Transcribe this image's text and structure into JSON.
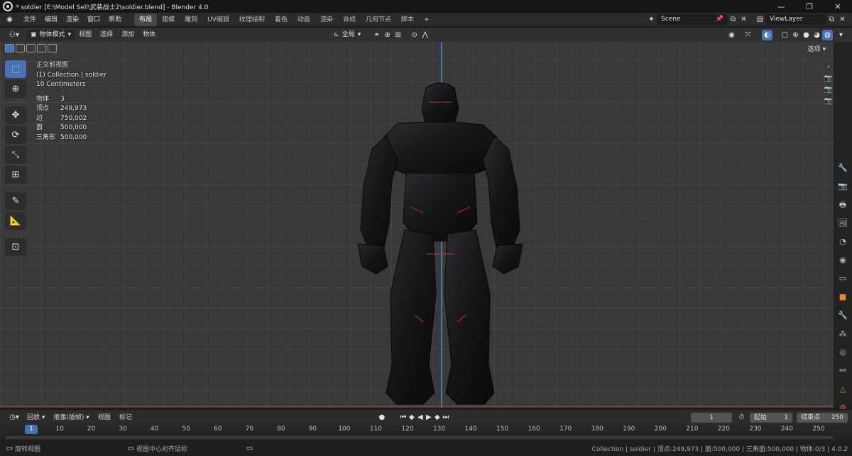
{
  "titlebar": {
    "title": "* soldier [E:\\Model Sell\\武装战士2\\soldier.blend] - Blender 4.0",
    "minimize": "—",
    "maximize": "❐",
    "close": "✕"
  },
  "menus": [
    "文件",
    "编辑",
    "渲染",
    "窗口",
    "帮助"
  ],
  "workspaces": [
    "布局",
    "建模",
    "雕刻",
    "UV编辑",
    "纹理绘制",
    "着色",
    "动画",
    "渲染",
    "合成",
    "几何节点",
    "脚本"
  ],
  "workspace_add": "+",
  "scene": "Scene",
  "view_layer": "ViewLayer",
  "header": {
    "mode": "物体模式",
    "view": "视图",
    "select": "选择",
    "add": "添加",
    "object": "物体",
    "orientation": "全局"
  },
  "overlay": {
    "view_name": "正交前视图",
    "collection": "(1) Collection | soldier",
    "scale": "10 Centimeters"
  },
  "stats": [
    {
      "k": "物体",
      "v": "3"
    },
    {
      "k": "顶点",
      "v": "249,973"
    },
    {
      "k": "边",
      "v": "750,002"
    },
    {
      "k": "面",
      "v": "500,000"
    },
    {
      "k": "三角形",
      "v": "500,000"
    }
  ],
  "options_label": "选项",
  "timeline": {
    "playback": "回放",
    "keying": "抠像(插帧)",
    "view": "视图",
    "marker": "标记",
    "current_frame": "1",
    "start_label": "起始",
    "start": "1",
    "end_label": "结束点",
    "end": "250"
  },
  "ruler_ticks": [
    "1",
    "10",
    "20",
    "30",
    "40",
    "50",
    "60",
    "70",
    "80",
    "90",
    "100",
    "110",
    "120",
    "130",
    "140",
    "150",
    "160",
    "170",
    "180",
    "190",
    "200",
    "210",
    "220",
    "230",
    "240",
    "250"
  ],
  "status": {
    "left": "旋转视图",
    "middle": "视图中心对齐鼠标",
    "right": "Collection | soldier | 顶点:249,973 | 面:500,000 | 三角面:500,000 | 物体:0/3 | 4.0.2"
  },
  "accent": "#4772b3",
  "icons": {
    "blender": "blender-logo-icon",
    "move": "move-icon",
    "rotate": "rotate-icon",
    "scale": "scale-icon",
    "camera": "camera-icon"
  }
}
